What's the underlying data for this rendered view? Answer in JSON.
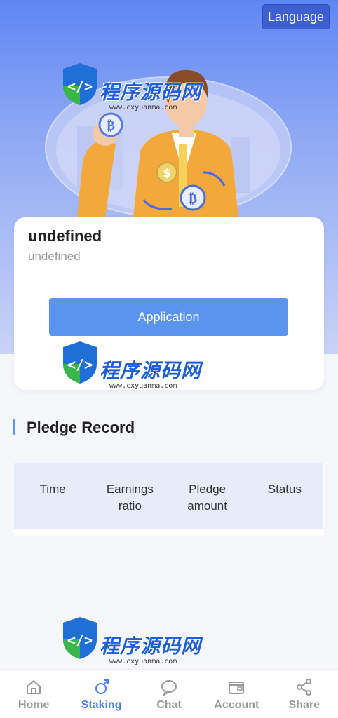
{
  "header": {
    "language_label": "Language"
  },
  "watermark": {
    "brand": "程序源码网",
    "url": "www.cxyuanma.com"
  },
  "card": {
    "title": "undefined",
    "subtitle": "undefined",
    "button_label": "Application"
  },
  "pledge": {
    "title": "Pledge Record",
    "columns": [
      {
        "line1": "Time",
        "line2": ""
      },
      {
        "line1": "Earnings",
        "line2": "ratio"
      },
      {
        "line1": "Pledge",
        "line2": "amount"
      },
      {
        "line1": "Status",
        "line2": ""
      }
    ]
  },
  "tabbar": {
    "items": [
      {
        "label": "Home",
        "icon": "home-icon",
        "active": false
      },
      {
        "label": "Staking",
        "icon": "staking-icon",
        "active": true
      },
      {
        "label": "Chat",
        "icon": "chat-icon",
        "active": false
      },
      {
        "label": "Account",
        "icon": "wallet-icon",
        "active": false
      },
      {
        "label": "Share",
        "icon": "share-icon",
        "active": false
      }
    ]
  },
  "colors": {
    "accent": "#5b94ee",
    "active_tab": "#4a7ee6",
    "language_button": "#3e5fd0"
  }
}
